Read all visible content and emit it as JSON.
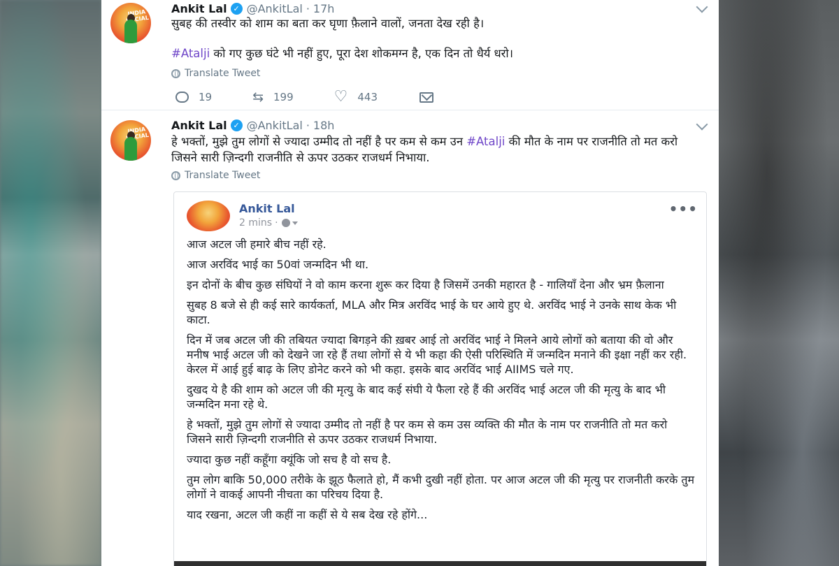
{
  "tweets": [
    {
      "name": "Ankit Lal",
      "handle": "@AnkitLal",
      "time": "17h",
      "text_line1": "सुबह की तस्वीर को शाम का बता कर घृणा फ़ैलाने वालों, जनता देख रही है।",
      "hashtag": "#Atalji",
      "text_line2_rest": " को गए कुछ घंटे भी नहीं हुए, पूरा देश शोकमग्न है, एक दिन तो धैर्य धरो।",
      "translate_label": "Translate Tweet",
      "replies": "19",
      "retweets": "199",
      "likes": "443"
    },
    {
      "name": "Ankit Lal",
      "handle": "@AnkitLal",
      "time": "18h",
      "text_part1": "हे भक्तों, मुझे तुम लोगों से ज्यादा उम्मीद तो नहीं है पर कम से कम उन ",
      "hashtag": "#Atalji",
      "text_part2": " की मौत के नाम पर राजनीति तो मत करो जिसने सारी ज़िन्दगी राजनीति से ऊपर उठकर राजधर्म निभाया.",
      "translate_label": "Translate Tweet"
    }
  ],
  "fb_post": {
    "author": "Ankit Lal",
    "time": "2 mins",
    "more_label": "•••",
    "paragraphs": [
      "आज अटल जी हमारे बीच नहीं रहे.",
      "आज अरविंद भाई का 50वां जन्मदिन भी था.",
      "इन दोनों के बीच कुछ संघियों ने वो काम करना शुरू कर दिया है जिसमें उनकी महारत है - गालियाँ देना और भ्रम फ़ैलाना",
      "सुबह 8 बजे से ही कई सारे कार्यकर्ता, MLA और मित्र अरविंद भाई के घर आये हुए थे. अरविंद भाई ने उनके साथ केक भी काटा.",
      "दिन में जब अटल जी की तबियत ज्यादा बिगड़ने की ख़बर आई तो अरविंद भाई ने मिलने आये लोगों को बताया की वो और मनीष भाई अटल जी को देखने जा रहे हैं तथा लोगों से ये भी कहा की ऐसी परिस्थिति में जन्मदिन मनाने की इक्षा नहीं कर रही. केरल में आई हुई बाढ़ के लिए डोनेट करने को भी कहा. इसके बाद अरविंद भाई AIIMS चले गए.",
      "दुखद ये है की शाम को अटल जी की मृत्यु के बाद कई संघी ये फैला रहे हैं की अरविंद भाई अटल जी की मृत्यु के बाद भी जन्मदिन मना रहे थे.",
      "हे भक्तों, मुझे तुम लोगों से ज्यादा उम्मीद तो नहीं है पर कम से कम उस व्यक्ति की मौत के नाम पर राजनीति तो मत करो जिसने सारी ज़िन्दगी राजनीति से ऊपर उठकर राजधर्म निभाया.",
      "ज्यादा कुछ नहीं कहूँगा क्यूंकि जो सच है वो सच है.",
      "तुम लोग बाकि 50,000 तरीके के झूठ फैलाते हो, मैं कभी दुखी नहीं होता. पर आज अटल जी की मृत्यु पर राजनीती करके तुम लोगों ने वाकई आपनी नीचता का परिचय दिया है.",
      "याद रखना, अटल जी कहीं ना कहीं से ये सब देख रहे होंगे..."
    ]
  },
  "avatar_text": "INDIA SOCIAL",
  "icons": {
    "verified": "verified-badge-icon",
    "chevron": "chevron-down-icon",
    "reply": "reply-icon",
    "retweet": "retweet-icon",
    "like": "heart-icon",
    "dm": "mail-icon",
    "globe": "globe-icon"
  },
  "colors": {
    "accent_blue": "#1da1f2",
    "hashtag_purple": "#6f46c8",
    "fb_name_blue": "#365899",
    "muted_gray": "#657786"
  }
}
